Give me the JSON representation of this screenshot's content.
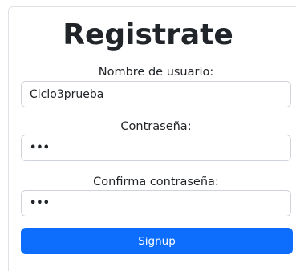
{
  "form": {
    "title": "Registrate",
    "username_label": "Nombre de usuario:",
    "username_value": "Ciclo3prueba",
    "password_label": "Contraseña:",
    "password_value": "•••",
    "confirm_label": "Confirma contraseña:",
    "confirm_value": "•••",
    "submit_label": "Signup"
  },
  "colors": {
    "primary": "#0d6efd",
    "border": "#ced4da",
    "text": "#212529"
  }
}
